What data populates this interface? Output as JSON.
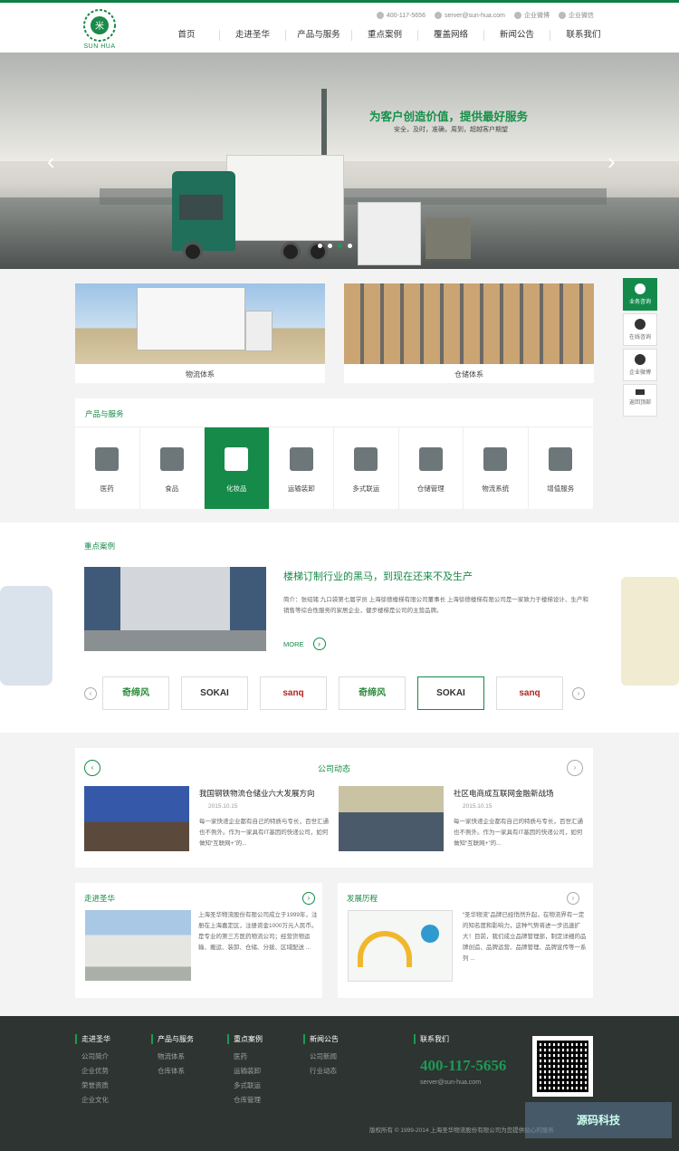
{
  "header": {
    "brand": "SUN HUA",
    "phone": "400-117-5656",
    "email": "server@sun-hua.com",
    "weibo": "企业微博",
    "wechat": "企业微信",
    "nav": [
      "首页",
      "走进圣华",
      "产品与服务",
      "重点案例",
      "覆盖网络",
      "新闻公告",
      "联系我们"
    ]
  },
  "banner": {
    "slogan": "为客户创造价值，提供最好服务",
    "sub": "安全，及时，准确，周到，超越客户期望",
    "prev": "‹",
    "next": "›"
  },
  "sidebar": [
    "业务咨询",
    "在线咨询",
    "企业微博",
    "返回顶部"
  ],
  "systems": [
    {
      "label": "物流体系"
    },
    {
      "label": "仓储体系"
    }
  ],
  "products": {
    "title": "产品与服务",
    "items": [
      "医药",
      "食品",
      "化妆品",
      "运输装卸",
      "多式联运",
      "仓储管理",
      "物流系统",
      "增值服务"
    ]
  },
  "cases": {
    "title": "重点案例",
    "headline": "楼梯订制行业的黑马，到现在还来不及生产",
    "desc": "简介：张绍锗 九口袋第七届学员 上海徐德楼梯有限公司董事长 上海徐德楼梯有限公司是一家致力于楼梯设计、生产和销售等综合性服务的家居企业，健步楼梯是公司的主营品牌。",
    "more": "MORE",
    "logos": [
      "奇缔风",
      "SOKAI",
      "sanq",
      "奇缔风",
      "SOKAI",
      "sanq"
    ]
  },
  "news": {
    "title": "公司动态",
    "items": [
      {
        "title": "我国钢铁物流仓储业六大发展方向",
        "date": "2015.10.15",
        "desc": "每一家快递企业都有自己的特质与专长，百世汇通也不例外。作为一家具有IT基因的快递公司，如何做知“互联网+”的..."
      },
      {
        "title": "社区电商成互联网金融新战场",
        "date": "2015.10.15",
        "desc": "每一家快递企业都有自己的特质与专长，百世汇通也不例外。作为一家具有IT基因的快递公司，如何做知“互联网+”的..."
      }
    ]
  },
  "about": {
    "title": "走进圣华",
    "desc": "上海圣华物流股份有限公司成立于1999年，注册在上海嘉定区，注册资金1000万元人民币。是专业的第三方医药物流公司；经营货物运输、搬运、装卸、仓储、分拨、区域配送 ..."
  },
  "history": {
    "title": "发展历程",
    "desc": "“圣华物流”品牌已经悄然升起，在物流界有一定的知名度和影响力，这种气势将进一步迅速扩大！目前，我们成立品牌管理部，制定详细的品牌创造、品牌运营、品牌管理、品牌宣传等一系列 ..."
  },
  "footer": {
    "cols": [
      {
        "h": "走进圣华",
        "items": [
          "公司简介",
          "企业优势",
          "荣誉资质",
          "企业文化"
        ]
      },
      {
        "h": "产品与服务",
        "items": [
          "物流体系",
          "仓库体系"
        ]
      },
      {
        "h": "重点案例",
        "items": [
          "医药",
          "运输装卸",
          "多式联运",
          "仓库管理"
        ]
      },
      {
        "h": "新闻公告",
        "items": [
          "公司新闻",
          "行业动态"
        ]
      }
    ],
    "contact": "联系我们",
    "phone": "400-117-5656",
    "email": "server@sun-hua.com",
    "copyright": "版权所有 © 1999-2014 上海圣华物流股份有限公司为您提供贴心的服务"
  },
  "watermark": "源码科技"
}
